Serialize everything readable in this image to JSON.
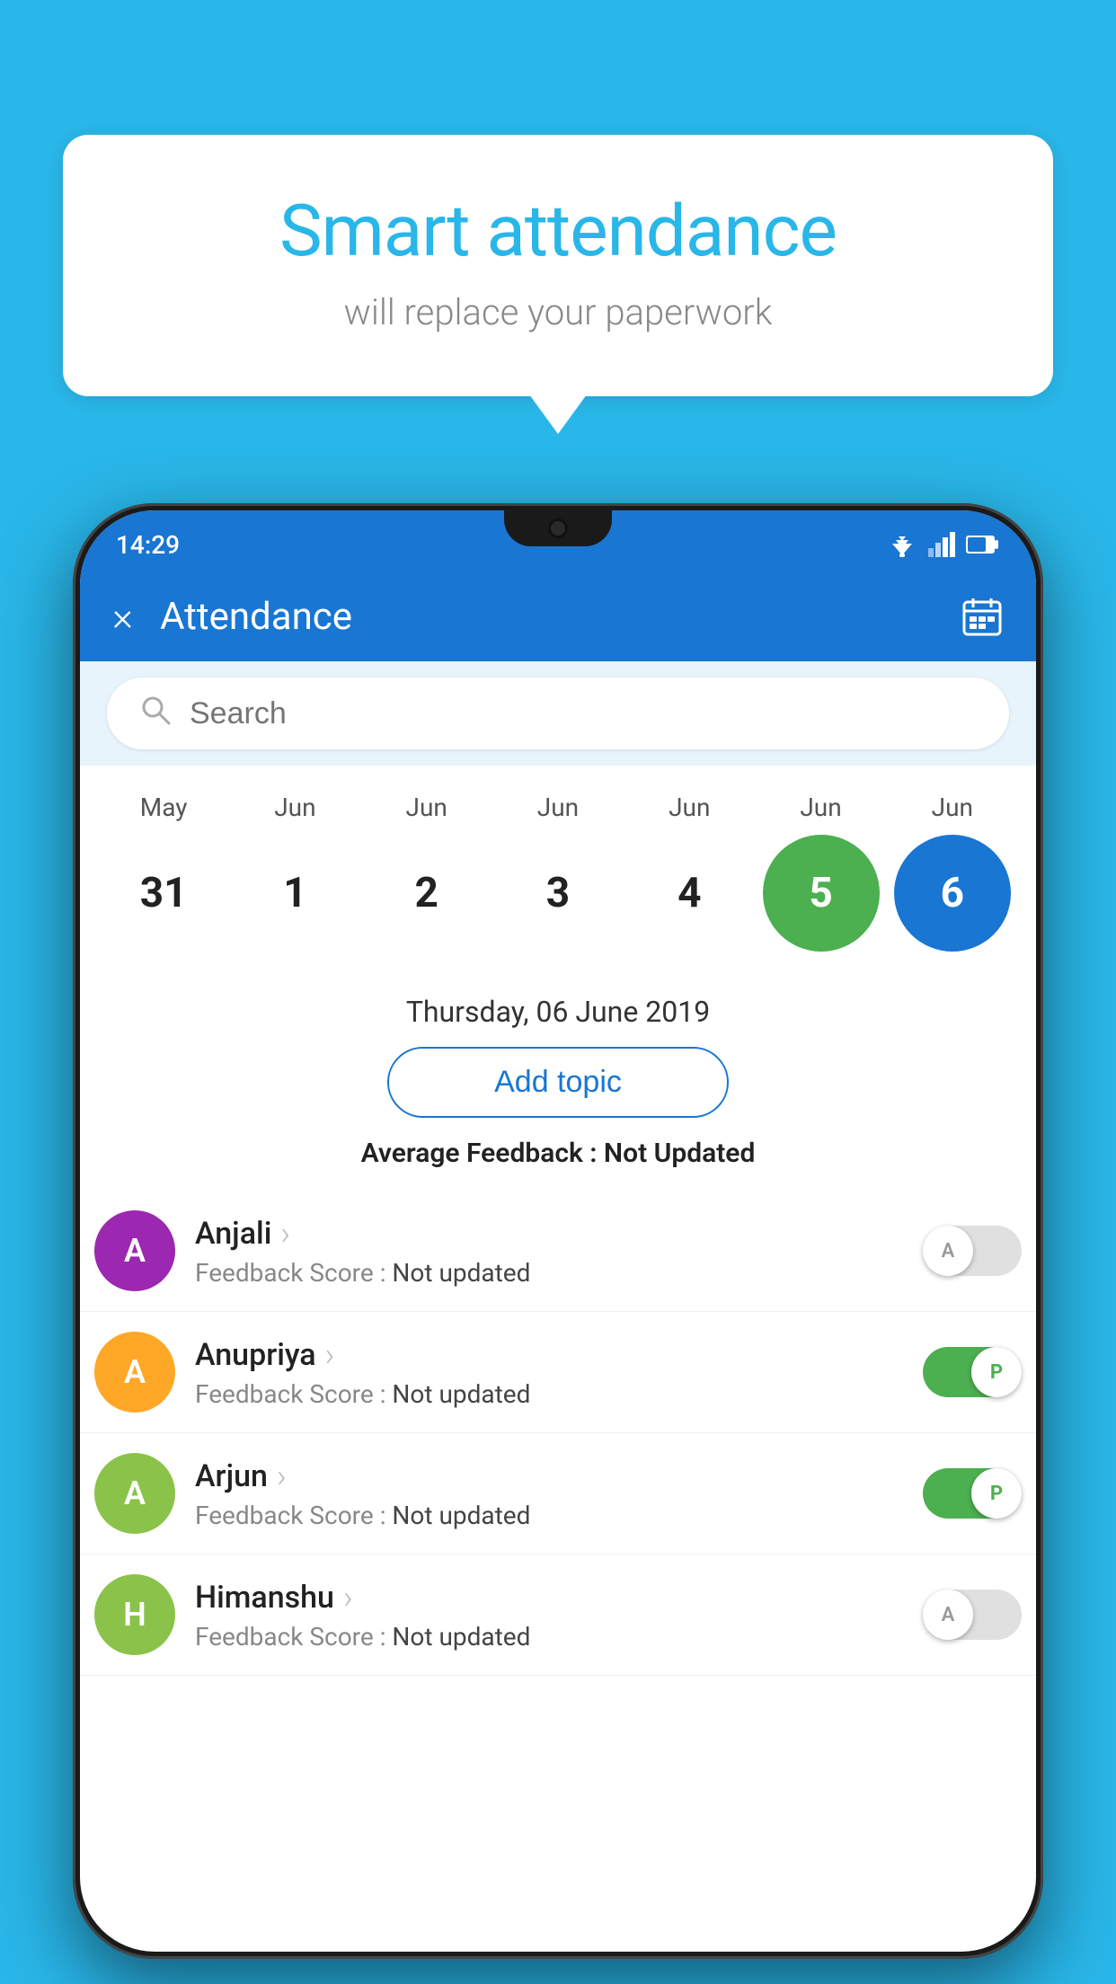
{
  "background": {
    "color": "#29b6e8"
  },
  "speech_bubble": {
    "title": "Smart attendance",
    "subtitle": "will replace your paperwork"
  },
  "status_bar": {
    "time": "14:29"
  },
  "app_bar": {
    "title": "Attendance",
    "close_label": "×"
  },
  "search": {
    "placeholder": "Search"
  },
  "calendar": {
    "days": [
      {
        "month": "May",
        "date": "31"
      },
      {
        "month": "Jun",
        "date": "1"
      },
      {
        "month": "Jun",
        "date": "2"
      },
      {
        "month": "Jun",
        "date": "3"
      },
      {
        "month": "Jun",
        "date": "4"
      },
      {
        "month": "Jun",
        "date": "5",
        "state": "today"
      },
      {
        "month": "Jun",
        "date": "6",
        "state": "selected"
      }
    ],
    "selected_date_label": "Thursday, 06 June 2019"
  },
  "add_topic_button": "Add topic",
  "average_feedback": {
    "label": "Average Feedback : ",
    "value": "Not Updated"
  },
  "students": [
    {
      "name": "Anjali",
      "avatar_letter": "A",
      "avatar_color": "#9c27b0",
      "feedback_label": "Feedback Score : ",
      "feedback_value": "Not updated",
      "toggle_state": "off",
      "toggle_letter": "A"
    },
    {
      "name": "Anupriya",
      "avatar_letter": "A",
      "avatar_color": "#ffa726",
      "feedback_label": "Feedback Score : ",
      "feedback_value": "Not updated",
      "toggle_state": "on",
      "toggle_letter": "P"
    },
    {
      "name": "Arjun",
      "avatar_letter": "A",
      "avatar_color": "#8bc34a",
      "feedback_label": "Feedback Score : ",
      "feedback_value": "Not updated",
      "toggle_state": "on",
      "toggle_letter": "P"
    },
    {
      "name": "Himanshu",
      "avatar_letter": "H",
      "avatar_color": "#8bc34a",
      "feedback_label": "Feedback Score : ",
      "feedback_value": "Not updated",
      "toggle_state": "off",
      "toggle_letter": "A"
    }
  ]
}
